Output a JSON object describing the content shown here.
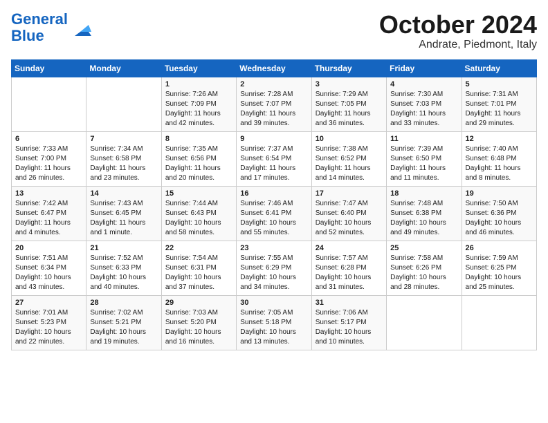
{
  "header": {
    "logo_general": "General",
    "logo_blue": "Blue",
    "title": "October 2024",
    "subtitle": "Andrate, Piedmont, Italy"
  },
  "weekdays": [
    "Sunday",
    "Monday",
    "Tuesday",
    "Wednesday",
    "Thursday",
    "Friday",
    "Saturday"
  ],
  "weeks": [
    [
      {
        "day": "",
        "text": ""
      },
      {
        "day": "",
        "text": ""
      },
      {
        "day": "1",
        "text": "Sunrise: 7:26 AM\nSunset: 7:09 PM\nDaylight: 11 hours and 42 minutes."
      },
      {
        "day": "2",
        "text": "Sunrise: 7:28 AM\nSunset: 7:07 PM\nDaylight: 11 hours and 39 minutes."
      },
      {
        "day": "3",
        "text": "Sunrise: 7:29 AM\nSunset: 7:05 PM\nDaylight: 11 hours and 36 minutes."
      },
      {
        "day": "4",
        "text": "Sunrise: 7:30 AM\nSunset: 7:03 PM\nDaylight: 11 hours and 33 minutes."
      },
      {
        "day": "5",
        "text": "Sunrise: 7:31 AM\nSunset: 7:01 PM\nDaylight: 11 hours and 29 minutes."
      }
    ],
    [
      {
        "day": "6",
        "text": "Sunrise: 7:33 AM\nSunset: 7:00 PM\nDaylight: 11 hours and 26 minutes."
      },
      {
        "day": "7",
        "text": "Sunrise: 7:34 AM\nSunset: 6:58 PM\nDaylight: 11 hours and 23 minutes."
      },
      {
        "day": "8",
        "text": "Sunrise: 7:35 AM\nSunset: 6:56 PM\nDaylight: 11 hours and 20 minutes."
      },
      {
        "day": "9",
        "text": "Sunrise: 7:37 AM\nSunset: 6:54 PM\nDaylight: 11 hours and 17 minutes."
      },
      {
        "day": "10",
        "text": "Sunrise: 7:38 AM\nSunset: 6:52 PM\nDaylight: 11 hours and 14 minutes."
      },
      {
        "day": "11",
        "text": "Sunrise: 7:39 AM\nSunset: 6:50 PM\nDaylight: 11 hours and 11 minutes."
      },
      {
        "day": "12",
        "text": "Sunrise: 7:40 AM\nSunset: 6:48 PM\nDaylight: 11 hours and 8 minutes."
      }
    ],
    [
      {
        "day": "13",
        "text": "Sunrise: 7:42 AM\nSunset: 6:47 PM\nDaylight: 11 hours and 4 minutes."
      },
      {
        "day": "14",
        "text": "Sunrise: 7:43 AM\nSunset: 6:45 PM\nDaylight: 11 hours and 1 minute."
      },
      {
        "day": "15",
        "text": "Sunrise: 7:44 AM\nSunset: 6:43 PM\nDaylight: 10 hours and 58 minutes."
      },
      {
        "day": "16",
        "text": "Sunrise: 7:46 AM\nSunset: 6:41 PM\nDaylight: 10 hours and 55 minutes."
      },
      {
        "day": "17",
        "text": "Sunrise: 7:47 AM\nSunset: 6:40 PM\nDaylight: 10 hours and 52 minutes."
      },
      {
        "day": "18",
        "text": "Sunrise: 7:48 AM\nSunset: 6:38 PM\nDaylight: 10 hours and 49 minutes."
      },
      {
        "day": "19",
        "text": "Sunrise: 7:50 AM\nSunset: 6:36 PM\nDaylight: 10 hours and 46 minutes."
      }
    ],
    [
      {
        "day": "20",
        "text": "Sunrise: 7:51 AM\nSunset: 6:34 PM\nDaylight: 10 hours and 43 minutes."
      },
      {
        "day": "21",
        "text": "Sunrise: 7:52 AM\nSunset: 6:33 PM\nDaylight: 10 hours and 40 minutes."
      },
      {
        "day": "22",
        "text": "Sunrise: 7:54 AM\nSunset: 6:31 PM\nDaylight: 10 hours and 37 minutes."
      },
      {
        "day": "23",
        "text": "Sunrise: 7:55 AM\nSunset: 6:29 PM\nDaylight: 10 hours and 34 minutes."
      },
      {
        "day": "24",
        "text": "Sunrise: 7:57 AM\nSunset: 6:28 PM\nDaylight: 10 hours and 31 minutes."
      },
      {
        "day": "25",
        "text": "Sunrise: 7:58 AM\nSunset: 6:26 PM\nDaylight: 10 hours and 28 minutes."
      },
      {
        "day": "26",
        "text": "Sunrise: 7:59 AM\nSunset: 6:25 PM\nDaylight: 10 hours and 25 minutes."
      }
    ],
    [
      {
        "day": "27",
        "text": "Sunrise: 7:01 AM\nSunset: 5:23 PM\nDaylight: 10 hours and 22 minutes."
      },
      {
        "day": "28",
        "text": "Sunrise: 7:02 AM\nSunset: 5:21 PM\nDaylight: 10 hours and 19 minutes."
      },
      {
        "day": "29",
        "text": "Sunrise: 7:03 AM\nSunset: 5:20 PM\nDaylight: 10 hours and 16 minutes."
      },
      {
        "day": "30",
        "text": "Sunrise: 7:05 AM\nSunset: 5:18 PM\nDaylight: 10 hours and 13 minutes."
      },
      {
        "day": "31",
        "text": "Sunrise: 7:06 AM\nSunset: 5:17 PM\nDaylight: 10 hours and 10 minutes."
      },
      {
        "day": "",
        "text": ""
      },
      {
        "day": "",
        "text": ""
      }
    ]
  ]
}
